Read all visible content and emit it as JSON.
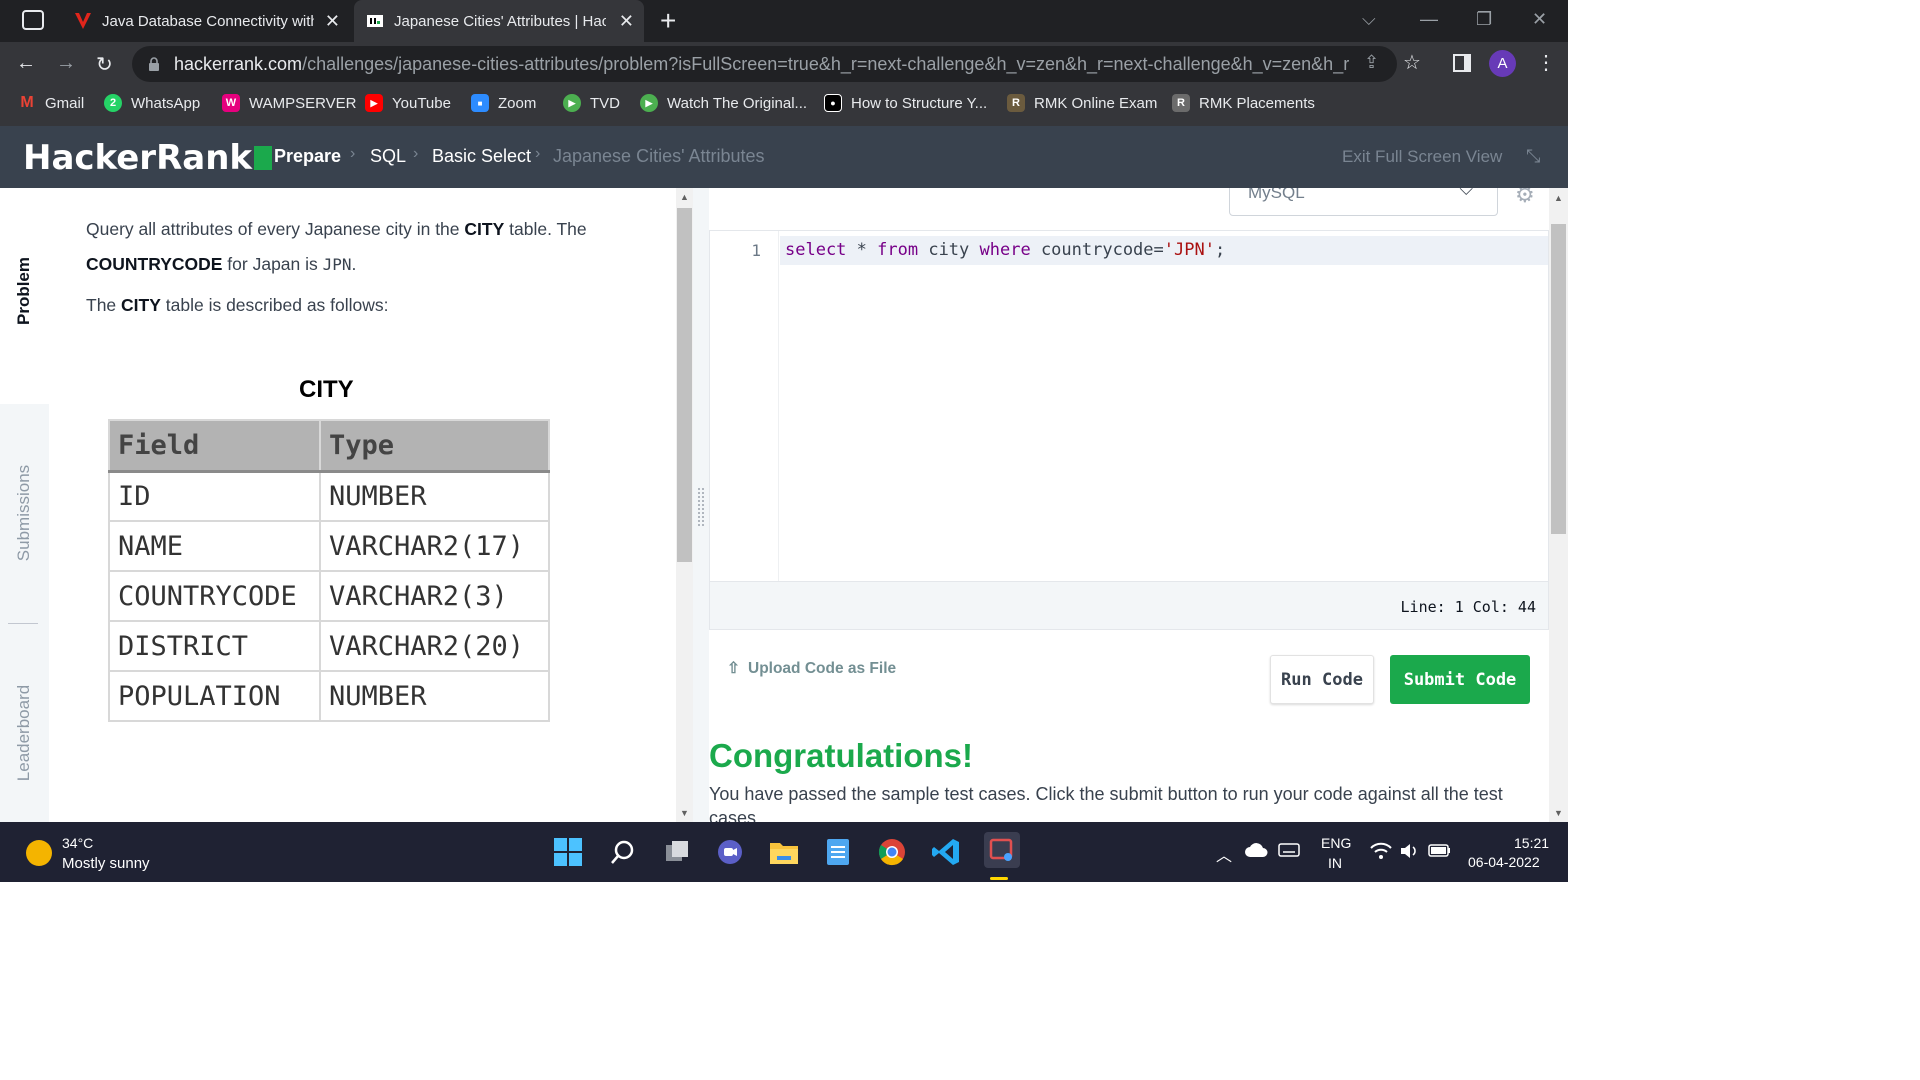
{
  "browser": {
    "tabs": [
      {
        "title": "Java Database Connectivity with MySQL",
        "active": false
      },
      {
        "title": "Japanese Cities' Attributes | HackerRank",
        "active": true
      }
    ],
    "new_tab_label": "+",
    "url_host": "hackerrank.com",
    "url_path": "/challenges/japanese-cities-attributes/problem?isFullScreen=true&h_r=next-challenge&h_v=zen&h_r=next-challenge&h_v=zen&h_r=nex...",
    "profile_initial": "A",
    "bookmarks": [
      {
        "label": "Gmail",
        "color": "#ea4335",
        "glyph": "M"
      },
      {
        "label": "WhatsApp",
        "color": "#25d366",
        "glyph": "2"
      },
      {
        "label": "WAMPSERVER",
        "color": "#e6007e",
        "glyph": "W"
      },
      {
        "label": "YouTube",
        "color": "#ff0000",
        "glyph": "▶"
      },
      {
        "label": "Zoom",
        "color": "#2d8cff",
        "glyph": "■"
      },
      {
        "label": "TVD",
        "color": "#4caf50",
        "glyph": "▶"
      },
      {
        "label": "Watch The Original...",
        "color": "#4caf50",
        "glyph": "▶"
      },
      {
        "label": "How to Structure Y...",
        "color": "#000000",
        "glyph": "●"
      },
      {
        "label": "RMK Online Exam",
        "color": "#6b5b3e",
        "glyph": "R"
      },
      {
        "label": "RMK Placements",
        "color": "#6b6b6b",
        "glyph": "R"
      }
    ]
  },
  "header": {
    "logo": "HackerRank",
    "breadcrumb": [
      "Prepare",
      "SQL",
      "Basic Select",
      "Japanese Cities' Attributes"
    ],
    "exit_fullscreen": "Exit Full Screen View",
    "accent": "#1ba94c",
    "bg": "#39424e"
  },
  "sidetabs": [
    "Problem",
    "Submissions",
    "Leaderboard"
  ],
  "problem": {
    "p1_a": "Query all attributes of every Japanese city in the ",
    "p1_b": "CITY",
    "p1_c": " table. The",
    "p2_a": "COUNTRYCODE",
    "p2_b": " for Japan is ",
    "p2_c": "JPN",
    "p2_d": ".",
    "p3_a": "The ",
    "p3_b": "CITY",
    "p3_c": " table is described as follows:",
    "table_caption": "CITY",
    "table_headers": [
      "Field",
      "Type"
    ],
    "table_rows": [
      [
        "ID",
        "NUMBER"
      ],
      [
        "NAME",
        "VARCHAR2(17)"
      ],
      [
        "COUNTRYCODE",
        "VARCHAR2(3)"
      ],
      [
        "DISTRICT",
        "VARCHAR2(20)"
      ],
      [
        "POPULATION",
        "NUMBER"
      ]
    ]
  },
  "editor": {
    "language": "MySQL",
    "line_number": "1",
    "code_kw1": "select",
    "code_mid1": " * ",
    "code_kw2": "from",
    "code_mid2": " city ",
    "code_kw3": "where",
    "code_mid3": " countrycode=",
    "code_str": "'JPN'",
    "code_end": ";",
    "status": "Line: 1 Col: 44",
    "upload_label": "Upload Code as File",
    "run_label": "Run Code",
    "submit_label": "Submit Code"
  },
  "result": {
    "title": "Congratulations!",
    "message": "You have passed the sample test cases. Click the submit button to run your code against all the test cases."
  },
  "taskbar": {
    "temp": "34°C",
    "weather": "Mostly sunny",
    "lang_top": "ENG",
    "lang_bottom": "IN",
    "time": "15:21",
    "date": "06-04-2022"
  }
}
